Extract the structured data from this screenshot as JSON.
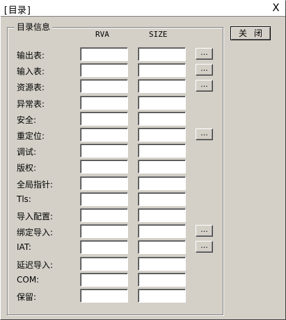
{
  "window": {
    "title": "[目录]",
    "close_glyph": "X"
  },
  "group": {
    "label": "目录信息",
    "col_rva": "RVA",
    "col_size": "SIZE"
  },
  "close_button": {
    "label": "关闭"
  },
  "rows": [
    {
      "label": "输出表:",
      "rva": "",
      "size": "",
      "has_button": true
    },
    {
      "label": "输入表:",
      "rva": "",
      "size": "",
      "has_button": true
    },
    {
      "label": "资源表:",
      "rva": "",
      "size": "",
      "has_button": true
    },
    {
      "label": "异常表:",
      "rva": "",
      "size": "",
      "has_button": false
    },
    {
      "label": "安全:",
      "rva": "",
      "size": "",
      "has_button": false
    },
    {
      "label": "重定位:",
      "rva": "",
      "size": "",
      "has_button": true
    },
    {
      "label": "调试:",
      "rva": "",
      "size": "",
      "has_button": false
    },
    {
      "label": "版权:",
      "rva": "",
      "size": "",
      "has_button": false
    },
    {
      "label": "全局指针:",
      "rva": "",
      "size": "",
      "has_button": false
    },
    {
      "label": "Tls:",
      "rva": "",
      "size": "",
      "has_button": false
    },
    {
      "label": "导入配置:",
      "rva": "",
      "size": "",
      "has_button": false
    },
    {
      "label": "绑定导入:",
      "rva": "",
      "size": "",
      "has_button": true
    },
    {
      "label": "IAT:",
      "rva": "",
      "size": "",
      "has_button": true
    },
    {
      "label": "延迟导入:",
      "rva": "",
      "size": "",
      "has_button": false
    },
    {
      "label": "COM:",
      "rva": "",
      "size": "",
      "has_button": false
    },
    {
      "label": "保留:",
      "rva": "",
      "size": "",
      "has_button": false
    }
  ],
  "detail_button_label": "..."
}
